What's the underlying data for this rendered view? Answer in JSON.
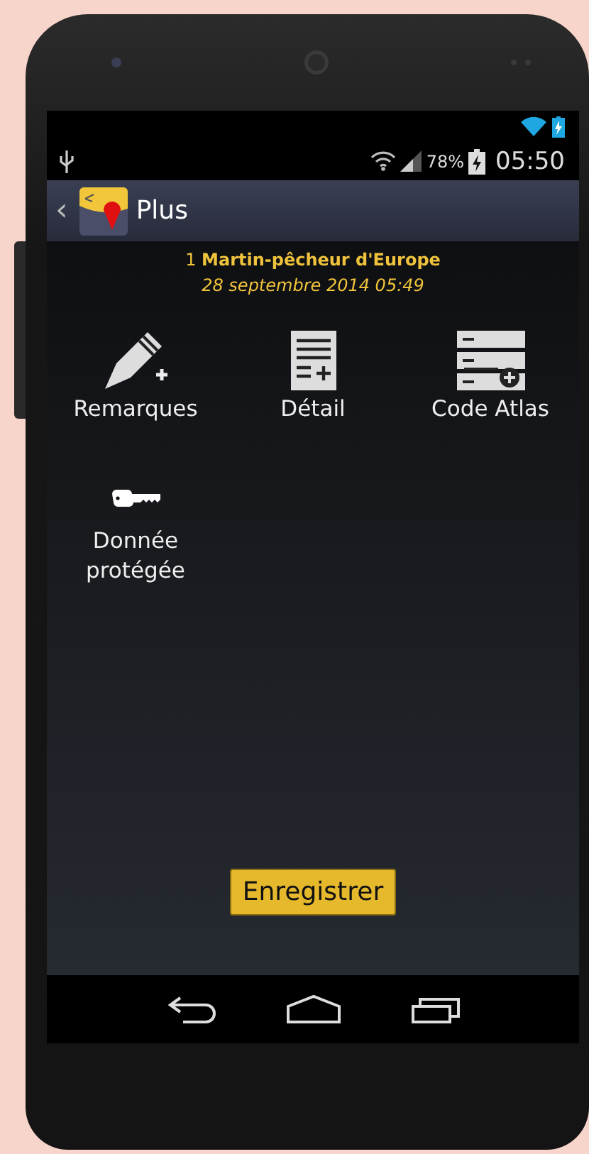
{
  "status_bar": {
    "battery_percent": "78%",
    "time": "05:50"
  },
  "action_bar": {
    "back": "‹",
    "title": "Plus"
  },
  "observation": {
    "count": "1",
    "species": "Martin-pêcheur d'Europe",
    "date": "28 septembre 2014 05:49"
  },
  "actions": [
    {
      "kind": "pencil",
      "label": "Remarques"
    },
    {
      "kind": "document",
      "label": "Détail"
    },
    {
      "kind": "atlas",
      "label": "Code Atlas"
    },
    {
      "kind": "key",
      "label": "Donnée protégée"
    }
  ],
  "save_button": "Enregistrer"
}
